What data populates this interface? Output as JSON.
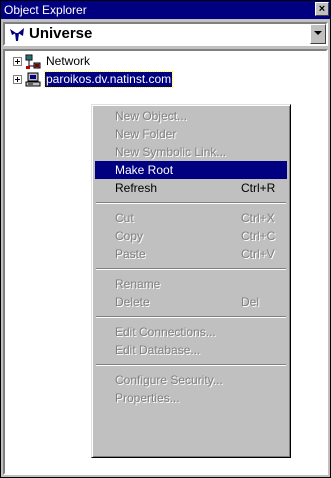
{
  "window": {
    "title": "Object Explorer",
    "close_glyph": "×"
  },
  "combo": {
    "value": "Universe",
    "icon": "ni-universe-icon"
  },
  "tree": {
    "items": [
      {
        "label": "Network",
        "icon": "network-icon",
        "expanded": false
      },
      {
        "label": "paroikos.dv.natinst.com",
        "icon": "computer-icon",
        "selected": true
      }
    ]
  },
  "context_menu": {
    "items": [
      {
        "label": "New Object...",
        "shortcut": "",
        "enabled": false
      },
      {
        "label": "New Folder",
        "shortcut": "",
        "enabled": false
      },
      {
        "label": "New Symbolic Link...",
        "shortcut": "",
        "enabled": false
      },
      {
        "label": "Make Root",
        "shortcut": "",
        "enabled": true,
        "highlighted": true
      },
      {
        "label": "Refresh",
        "shortcut": "Ctrl+R",
        "enabled": true
      },
      {
        "label": "Cut",
        "shortcut": "Ctrl+X",
        "enabled": false
      },
      {
        "label": "Copy",
        "shortcut": "Ctrl+C",
        "enabled": false
      },
      {
        "label": "Paste",
        "shortcut": "Ctrl+V",
        "enabled": false
      },
      {
        "label": "Rename",
        "shortcut": "",
        "enabled": false
      },
      {
        "label": "Delete",
        "shortcut": "Del",
        "enabled": false
      },
      {
        "label": "Edit Connections...",
        "shortcut": "",
        "enabled": false
      },
      {
        "label": "Edit Database...",
        "shortcut": "",
        "enabled": false
      },
      {
        "label": "Configure Security...",
        "shortcut": "",
        "enabled": false
      },
      {
        "label": "Properties...",
        "shortcut": "",
        "enabled": false
      }
    ]
  },
  "colors": {
    "title_bar": "#000080",
    "selection": "#000080",
    "face": "#c0c0c0",
    "disabled_text": "#808080"
  }
}
